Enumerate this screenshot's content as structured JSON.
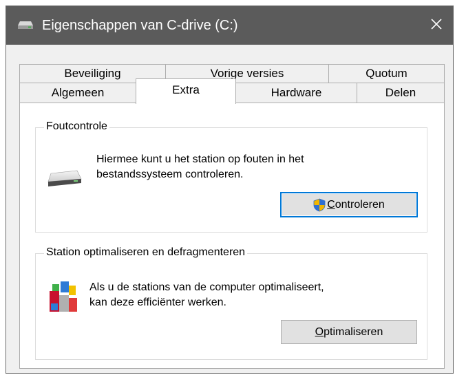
{
  "window": {
    "title": "Eigenschappen van C-drive (C:)"
  },
  "tabs": {
    "row1": [
      "Beveiliging",
      "Vorige versies",
      "Quotum"
    ],
    "row2": [
      "Algemeen",
      "Extra",
      "Hardware",
      "Delen"
    ],
    "active": "Extra"
  },
  "error_check": {
    "legend": "Foutcontrole",
    "description_line1": "Hiermee kunt u het station op fouten in het",
    "description_line2": "bestandssysteem controleren.",
    "button_label": "Controleren"
  },
  "optimize": {
    "legend": "Station optimaliseren en defragmenteren",
    "description_line1": "Als u de stations van de computer optimaliseert,",
    "description_line2": "kan deze efficiënter werken.",
    "button_label": "Optimaliseren"
  },
  "icons": {
    "title": "drive-icon",
    "close": "close-icon",
    "error_check": "hard-drive-icon",
    "shield": "uac-shield-icon",
    "optimize": "defragment-icon"
  },
  "colors": {
    "titlebar": "#5b5b5b",
    "focus_border": "#0078d7",
    "button_bg": "#e1e1e1"
  }
}
